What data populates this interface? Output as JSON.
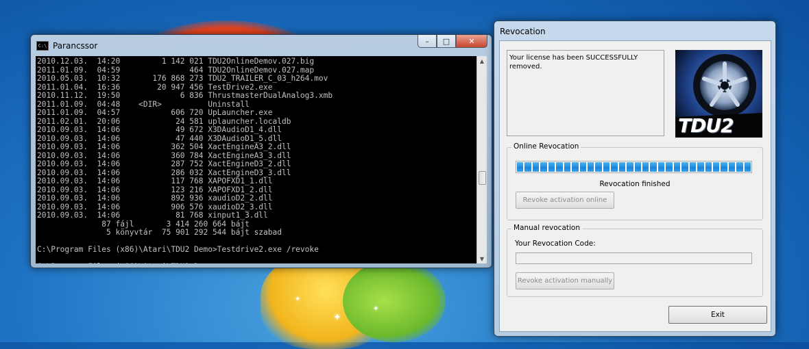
{
  "cmd_window": {
    "title": "Parancssor",
    "icon": "cmd-icon",
    "icon_text": "C:\\",
    "lines": [
      "2010.12.03.  14:20         1 142 021 TDU2OnlineDemov.027.big",
      "2011.01.09.  04:59               464 TDU2OnlineDemov.027.map",
      "2010.05.03.  10:32       176 868 273 TDU2_TRAILER_C_03_h264.mov",
      "2011.01.04.  16:36        20 947 456 TestDrive2.exe",
      "2010.11.12.  19:50             6 836 ThrustmasterDualAnalog3.xmb",
      "2011.01.09.  04:48    <DIR>          Uninstall",
      "2011.01.09.  04:57           606 720 UpLauncher.exe",
      "2011.02.01.  20:06            24 581 uplauncher.localdb",
      "2010.09.03.  14:06            49 672 X3DAudioD1_4.dll",
      "2010.09.03.  14:06            47 440 X3DAudioD1_5.dll",
      "2010.09.03.  14:06           362 504 XactEngineA3_2.dll",
      "2010.09.03.  14:06           360 784 XactEngineA3_3.dll",
      "2010.09.03.  14:06           287 752 XactEngineD3_2.dll",
      "2010.09.03.  14:06           286 032 XactEngineD3_3.dll",
      "2010.09.03.  14:06           117 768 XAPOFXD1_1.dll",
      "2010.09.03.  14:06           123 216 XAPOFXD1_2.dll",
      "2010.09.03.  14:06           892 936 xaudioD2_2.dll",
      "2010.09.03.  14:06           906 576 xaudioD2_3.dll",
      "2010.09.03.  14:06            81 768 xinput1_3.dll",
      "              87 fájl       3 414 260 664 bájt",
      "               5 könyvtár  75 901 292 544 bájt szabad",
      "",
      "C:\\Program Files (x86)\\Atari\\TDU2 Demo>Testdrive2.exe /revoke",
      "",
      "C:\\Program Files (x86)\\Atari\\TDU2 Demo>"
    ]
  },
  "dialog": {
    "title": "Revocation",
    "message": "Your license has been SUCCESSFULLY removed.",
    "logo_text": "TDU2",
    "online": {
      "label": "Online Revocation",
      "progress": 1.0,
      "status": "Revocation finished",
      "button": "Revoke activation online"
    },
    "manual": {
      "label": "Manual revocation",
      "code_label": "Your Revocation Code:",
      "code_value": "",
      "button": "Revoke activation manually"
    },
    "exit_button": "Exit"
  },
  "window_buttons": {
    "minimize": "–",
    "maximize": "□",
    "close": "✕"
  },
  "colors": {
    "desktop": "#1e73c4",
    "console_bg": "#000000",
    "console_text": "#c0c0c0",
    "progress": "#1c85d6"
  }
}
